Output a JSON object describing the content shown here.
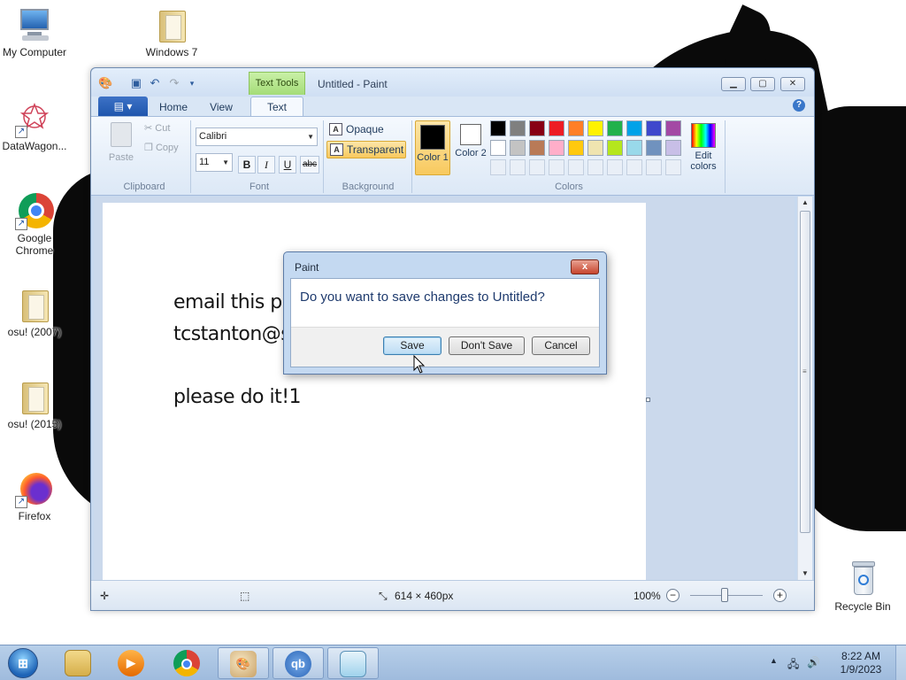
{
  "desktop": {
    "icons": [
      {
        "label": "My Computer",
        "icon": "computer-icon"
      },
      {
        "label": "Windows 7",
        "icon": "folder-icon"
      },
      {
        "label": "DataWagon...",
        "icon": "datawagon-icon"
      },
      {
        "label": "Google Chrome",
        "icon": "chrome-icon"
      },
      {
        "label": "osu! (2007)",
        "icon": "folder-icon"
      },
      {
        "label": "osu! (2015)",
        "icon": "folder-icon"
      },
      {
        "label": "Firefox",
        "icon": "firefox-icon"
      },
      {
        "label": "Recycle Bin",
        "icon": "recycle-bin-icon"
      }
    ]
  },
  "paint": {
    "window_title": "Untitled - Paint",
    "contextual_tab": "Text Tools",
    "tabs": [
      "Home",
      "View",
      "Text"
    ],
    "active_tab": "Text",
    "file_menu_icon": "file-menu-icon",
    "clipboard": {
      "paste": "Paste",
      "cut": "Cut",
      "copy": "Copy",
      "group": "Clipboard"
    },
    "font": {
      "family": "Calibri",
      "size": "11",
      "bold": "B",
      "italic": "I",
      "underline": "U",
      "strikethrough": "abc",
      "group": "Font"
    },
    "background": {
      "opaque": "Opaque",
      "transparent": "Transparent",
      "selected": "Transparent",
      "group": "Background"
    },
    "colors": {
      "color1_label": "Color 1",
      "color2_label": "Color 2",
      "color1_value": "#000000",
      "color2_value": "#ffffff",
      "edit_label": "Edit colors",
      "group": "Colors",
      "palette_row1": [
        "#000000",
        "#7f7f7f",
        "#880015",
        "#ed1c24",
        "#ff7f27",
        "#fff200",
        "#22b14c",
        "#00a2e8",
        "#3f48cc",
        "#a349a4"
      ],
      "palette_row2": [
        "#ffffff",
        "#c3c3c3",
        "#b97a57",
        "#ffaec9",
        "#ffc90e",
        "#efe4b0",
        "#b5e61d",
        "#99d9ea",
        "#7092be",
        "#c8bfe7"
      ]
    },
    "canvas_text": [
      "email this pe",
      "tcstanton@s",
      "please do it!1"
    ],
    "status": {
      "dimensions": "614 × 460px",
      "zoom": "100%"
    }
  },
  "dialog": {
    "title": "Paint",
    "message": "Do you want to save changes to Untitled?",
    "buttons": {
      "save": "Save",
      "dont_save": "Don't Save",
      "cancel": "Cancel"
    },
    "close": "x"
  },
  "taskbar": {
    "apps": [
      "File Explorer",
      "Windows Media Player",
      "Google Chrome",
      "Paint",
      "qBittorrent",
      "Notepad"
    ],
    "qbittorrent_label": "qb",
    "clock": {
      "time": "8:22 AM",
      "date": "1/9/2023"
    }
  }
}
